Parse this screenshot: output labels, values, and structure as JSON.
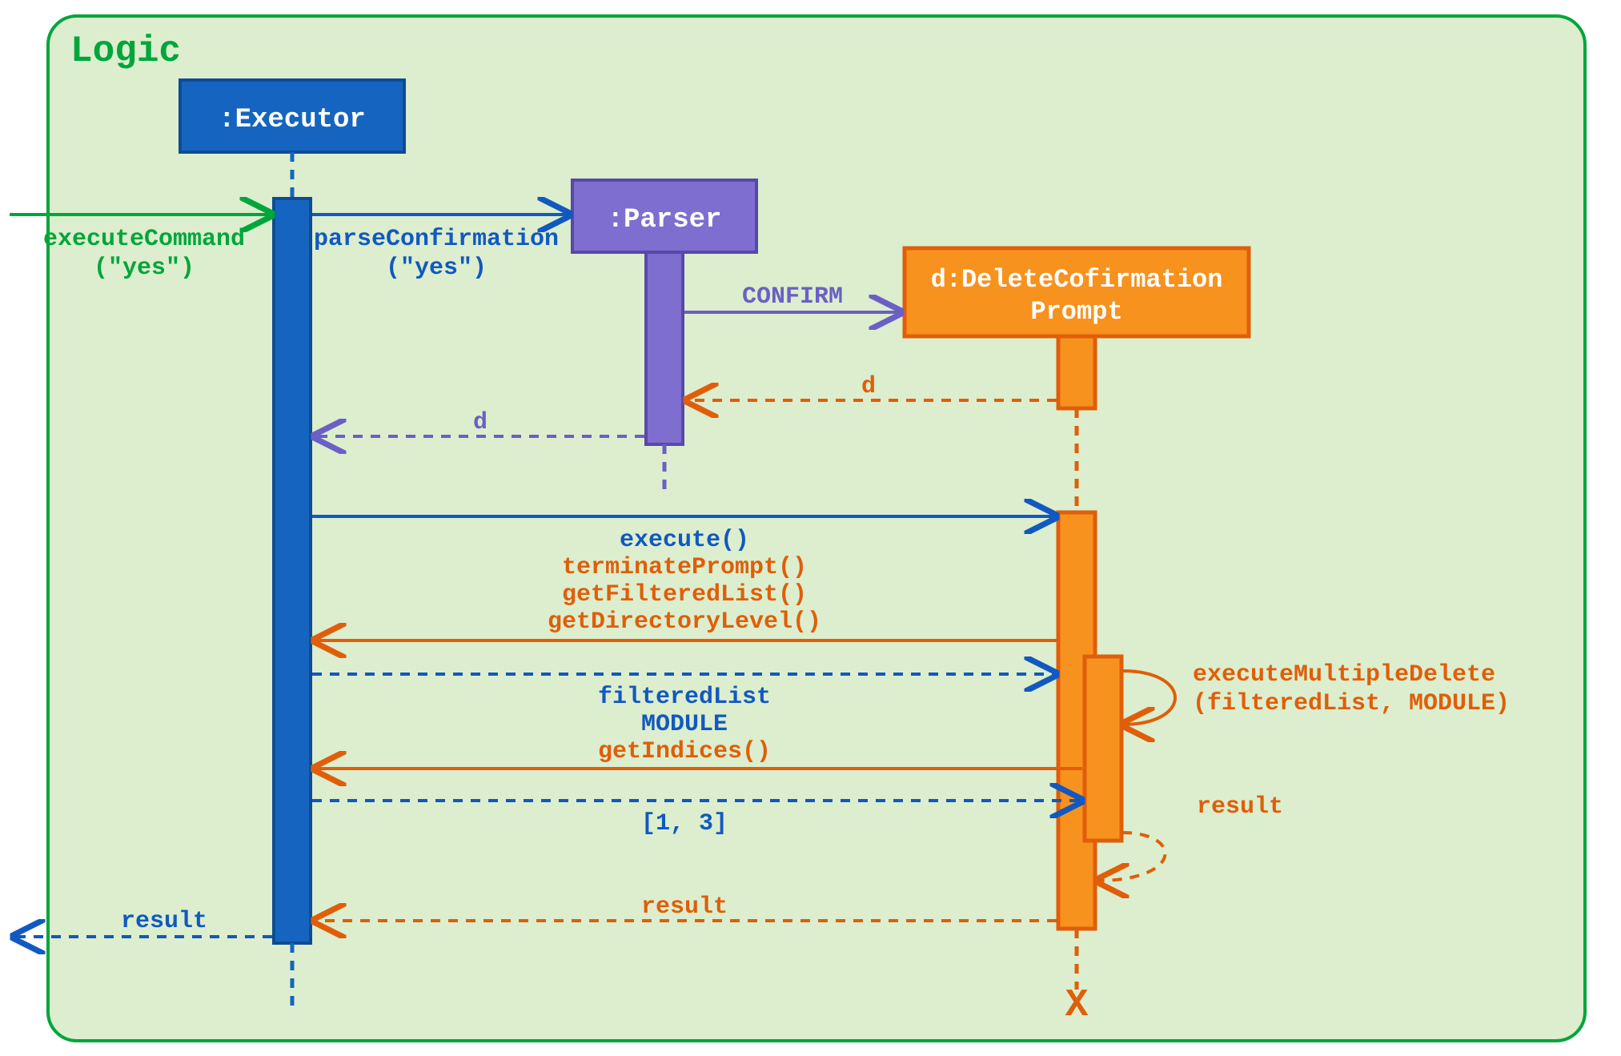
{
  "frame": {
    "label": "Logic",
    "borderColor": "#00a63b",
    "fillColor": "#dceecd",
    "labelColor": "#00a63b"
  },
  "actors": {
    "executor": {
      "name": ":Executor",
      "fill": "#1565c0",
      "border": "#0d4c94",
      "text": "#ffffff"
    },
    "parser": {
      "name": ":Parser",
      "fill": "#7e6ecf",
      "border": "#5848a8",
      "text": "#ffffff"
    },
    "prompt": {
      "name": "d:DeleteCofirmation",
      "name2": "Prompt",
      "fill": "#f7921e",
      "border": "#e05e09",
      "text": "#ffffff"
    }
  },
  "messages": {
    "executeCommand1": "executeCommand",
    "executeCommand2": "(\"yes\")",
    "parseConfirmation1": "parseConfirmation",
    "parseConfirmation2": "(\"yes\")",
    "confirm": "CONFIRM",
    "returnD1": "d",
    "returnD2": "d",
    "execute": "execute()",
    "terminatePrompt": "terminatePrompt()",
    "getFilteredList": "getFilteredList()",
    "getDirectoryLevel": "getDirectoryLevel()",
    "filteredList": "filteredList",
    "module": "MODULE",
    "execMultiple1": "executeMultipleDelete",
    "execMultiple2": "(filteredList, MODULE)",
    "getIndices": "getIndices()",
    "indicesReturn": "[1, 3]",
    "selfResult": "result",
    "resultBack": "result",
    "resultOut": "result"
  },
  "colors": {
    "green": "#00a63b",
    "blue": "#1159c1",
    "purple": "#6b5fc5",
    "orange": "#e05e09",
    "orangeText": "#e05e09"
  }
}
